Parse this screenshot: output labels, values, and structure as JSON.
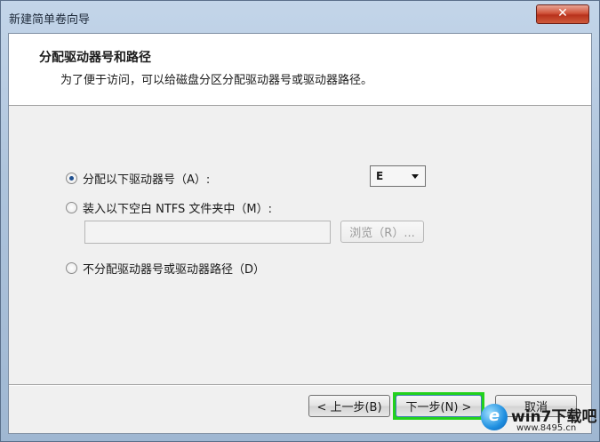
{
  "window": {
    "title": "新建简单卷向导",
    "close_glyph": "✕"
  },
  "header": {
    "title": "分配驱动器号和路径",
    "description": "为了便于访问，可以给磁盘分区分配驱动器号或驱动器路径。"
  },
  "options": {
    "assign_letter": {
      "label": "分配以下驱动器号（A）:",
      "checked": true
    },
    "mount_folder": {
      "label": "装入以下空白 NTFS 文件夹中（M）:",
      "checked": false
    },
    "no_assign": {
      "label": "不分配驱动器号或驱动器路径（D）",
      "checked": false
    }
  },
  "drive_select": {
    "value": "E"
  },
  "path_input": {
    "value": "",
    "placeholder": ""
  },
  "browse_button": {
    "label": "浏览（R）..."
  },
  "footer": {
    "back_label": "< 上一步(B)",
    "next_label": "下一步(N) >",
    "cancel_label": "取消"
  },
  "watermark": {
    "badge": "e",
    "text": "win7下载吧",
    "url": "www.8495.cn"
  },
  "colors": {
    "highlight_green": "#22d21c",
    "radio_dot": "#1f4f8f"
  }
}
